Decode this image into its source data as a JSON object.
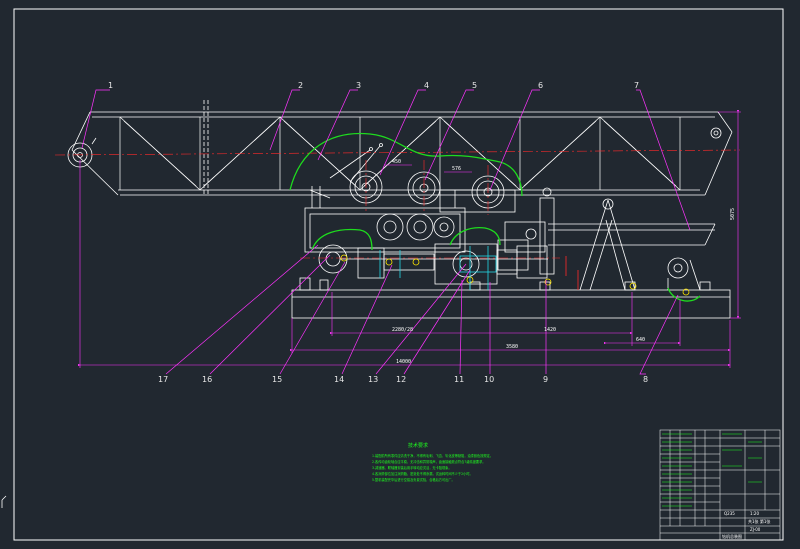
{
  "colors": {
    "background": "#212830",
    "frame": "#ffffff",
    "structure": "#ffffff",
    "leader": "#ff33ff",
    "centerline": "#ff2a2a",
    "guard": "#1edc1e",
    "dimension": "#ff33ff",
    "cyan": "#23d7e6",
    "yellow": "#ffe600",
    "notes": "#1eff1e"
  },
  "part_labels": [
    {
      "id": "1",
      "text": "1"
    },
    {
      "id": "2",
      "text": "2"
    },
    {
      "id": "3",
      "text": "3"
    },
    {
      "id": "4",
      "text": "4"
    },
    {
      "id": "5",
      "text": "5"
    },
    {
      "id": "6",
      "text": "6"
    },
    {
      "id": "7",
      "text": "7"
    },
    {
      "id": "8",
      "text": "8"
    },
    {
      "id": "9",
      "text": "9"
    },
    {
      "id": "10",
      "text": "10"
    },
    {
      "id": "11",
      "text": "11"
    },
    {
      "id": "12",
      "text": "12"
    },
    {
      "id": "13",
      "text": "13"
    },
    {
      "id": "14",
      "text": "14"
    },
    {
      "id": "15",
      "text": "15"
    },
    {
      "id": "16",
      "text": "16"
    },
    {
      "id": "17",
      "text": "17"
    }
  ],
  "dimensions": {
    "total_length": "14000",
    "base_length": "3580",
    "span_a": "2280/28",
    "span_b": "1420",
    "offset": "640",
    "height": "5075",
    "gear_a": "450",
    "gear_b": "576"
  },
  "technical_requirements": {
    "title": "技术要求",
    "lines": [
      "1.装配前所有零件应清洗干净，不得有毛刺、飞边、氧化皮等缺陷，油漆颜色按规定。",
      "2.各传动齿轮啮合应平稳，无冲击和异常噪声，齿面接触斑点符合7级精度要求。",
      "3.减速器、联轴器安装后用手转动应灵活，无卡阻现象。",
      "4.各润滑部位加注润滑脂，密封处不得渗漏，试运转时间不少于2小时。",
      "5.整机装配完毕后进行空载及负载试验，合格后方可出厂。"
    ]
  },
  "title_block": {
    "material": "Q235",
    "scale": "1:20",
    "sheet": "共1张 第1张",
    "drawing_no": "ZJ-00",
    "drawing_name": "钻机总装图"
  },
  "drawing": {
    "view": "front-elevation",
    "components": [
      "derrick-truss",
      "crown-sheave",
      "drawworks-drums",
      "gearbox",
      "motor",
      "a-frame-support",
      "base-skid",
      "guard-cover"
    ]
  }
}
